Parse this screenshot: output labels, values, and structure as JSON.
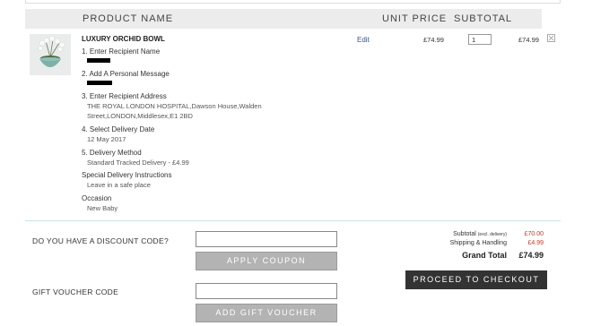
{
  "table_header": {
    "product": "PRODUCT NAME",
    "unit_price": "UNIT PRICE",
    "subtotal": "SUBTOTAL"
  },
  "item": {
    "name": "LUXURY ORCHID BOWL",
    "edit_label": "Edit",
    "unit_price": "£74.99",
    "quantity": "1",
    "subtotal": "£74.99",
    "image_icon": "orchid-bowl-image",
    "remove_icon": "remove-icon",
    "steps": [
      {
        "label": "1. Enter Recipient Name",
        "value": ""
      },
      {
        "label": "2. Add A Personal Message",
        "value": ""
      },
      {
        "label": "3. Enter Recipient Address",
        "value_line1": "THE ROYAL LONDON HOSPITAL,Dawson House,Walden",
        "value_line2": "Street,LONDON,Middlesex,E1 2BD"
      },
      {
        "label": "4. Select Delivery Date",
        "value": "12 May 2017"
      },
      {
        "label": "5. Delivery Method",
        "value": "Standard Tracked Delivery - £4.99"
      },
      {
        "label": "Special Delivery Instructions",
        "value": "Leave in a safe place"
      },
      {
        "label": "Occasion",
        "value": "New Baby"
      }
    ]
  },
  "discount": {
    "label": "DO YOU HAVE A DISCOUNT CODE?",
    "placeholder": "",
    "button": "APPLY COUPON"
  },
  "voucher": {
    "label": "GIFT VOUCHER CODE",
    "placeholder": "",
    "button": "ADD GIFT VOUCHER"
  },
  "summary": {
    "subtotal_label": "Subtotal",
    "subtotal_note": "(excl. delivery)",
    "subtotal_value": "£70.00",
    "shipping_label": "Shipping & Handling",
    "shipping_value": "£4.99",
    "grand_label": "Grand Total",
    "grand_value": "£74.99"
  },
  "checkout_button": "PROCEED TO CHECKOUT",
  "colors": {
    "header_bg": "#ececec",
    "link": "#2f55a4",
    "summary_value": "#c0392b",
    "button_grey": "#b3b3b3",
    "button_dark": "#333333"
  }
}
